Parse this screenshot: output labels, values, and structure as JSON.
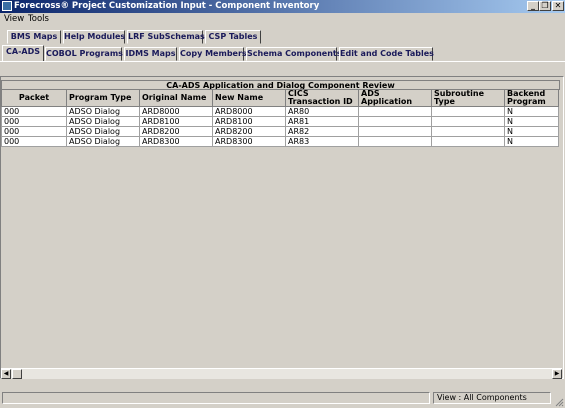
{
  "window": {
    "title": "Forecross® Project Customization Input - Component Inventory",
    "minimize_glyph": "_",
    "restore_glyph": "❐",
    "close_glyph": "✕"
  },
  "menu": [
    "View",
    "Tools"
  ],
  "tabs_row1": [
    "BMS Maps",
    "Help Modules",
    "LRF SubSchemas",
    "CSP Tables"
  ],
  "tabs_row2": [
    "CA-ADS",
    "COBOL Programs",
    "IDMS Maps",
    "Copy Members",
    "Schema Components",
    "Edit and Code Tables"
  ],
  "active_tab": "CA-ADS",
  "grid": {
    "caption": "CA-ADS Application and Dialog Component Review",
    "columns": [
      "Packet",
      "Program Type",
      "Original Name",
      "New Name",
      "CICS Transaction ID",
      "ADS Application",
      "Subroutine Type",
      "Backend Program"
    ],
    "rows": [
      [
        "000",
        "ADSO Dialog",
        "ARD8000",
        "ARD8000",
        "AR80",
        "",
        "",
        "N"
      ],
      [
        "000",
        "ADSO Dialog",
        "ARD8100",
        "ARD8100",
        "AR81",
        "",
        "",
        "N"
      ],
      [
        "000",
        "ADSO Dialog",
        "ARD8200",
        "ARD8200",
        "AR82",
        "",
        "",
        "N"
      ],
      [
        "000",
        "ADSO Dialog",
        "ARD8300",
        "ARD8300",
        "AR83",
        "",
        "",
        "N"
      ]
    ]
  },
  "statusbar": {
    "left": "",
    "right": "View : All Components"
  },
  "colors": {
    "titlebar_start": "#0a246a",
    "titlebar_end": "#a6caf0",
    "face": "#d4d0c8",
    "tab_text": "#1a1a5a"
  },
  "icons": {
    "app": "app-icon",
    "scroll_left": "arrow-left-icon",
    "scroll_right": "arrow-right-icon",
    "size_grip": "size-grip-icon"
  }
}
